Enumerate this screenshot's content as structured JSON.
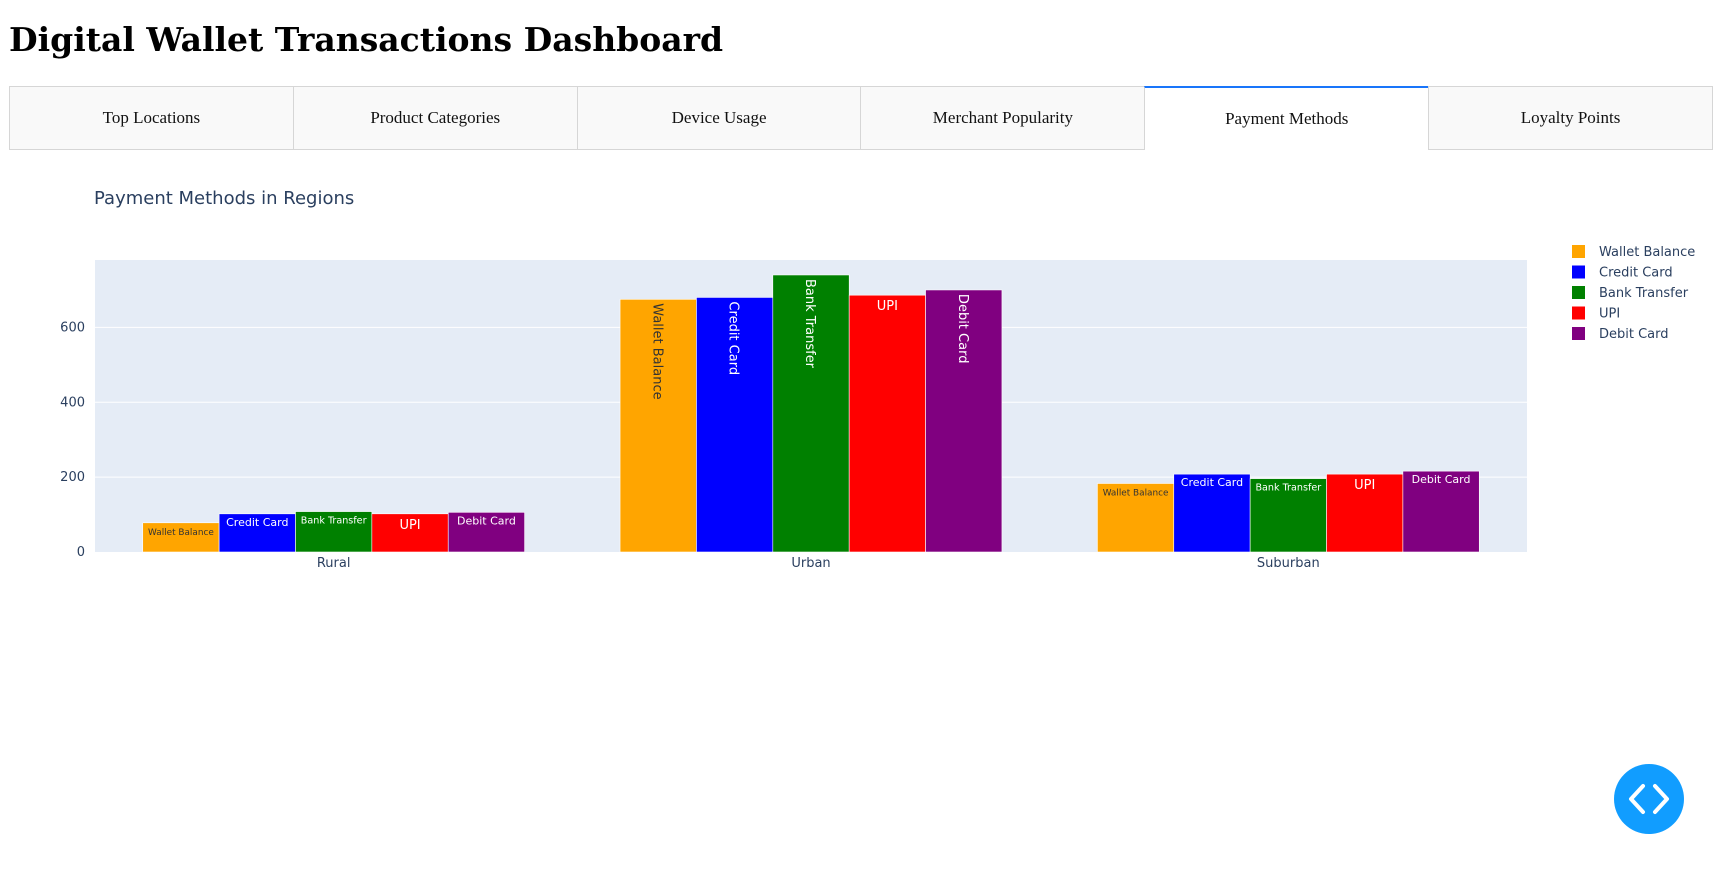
{
  "page": {
    "title": "Digital Wallet Transactions Dashboard"
  },
  "tabs": [
    {
      "label": "Top Locations",
      "selected": false
    },
    {
      "label": "Product Categories",
      "selected": false
    },
    {
      "label": "Device Usage",
      "selected": false
    },
    {
      "label": "Merchant Popularity",
      "selected": false
    },
    {
      "label": "Payment Methods",
      "selected": true
    },
    {
      "label": "Loyalty Points",
      "selected": false
    }
  ],
  "chart_data": {
    "type": "bar",
    "title": "Payment Methods in Regions",
    "xlabel": "",
    "ylabel": "",
    "categories": [
      "Rural",
      "Urban",
      "Suburban"
    ],
    "ylim": [
      0,
      780
    ],
    "yticks": [
      0,
      200,
      400,
      600
    ],
    "grid": true,
    "legend": "top-right",
    "series": [
      {
        "name": "Wallet Balance",
        "color": "#FFA500",
        "values": [
          78,
          675,
          183
        ]
      },
      {
        "name": "Credit Card",
        "color": "#0000FF",
        "values": [
          102,
          680,
          208
        ]
      },
      {
        "name": "Bank Transfer",
        "color": "#008000",
        "values": [
          108,
          740,
          196
        ]
      },
      {
        "name": "UPI",
        "color": "#FF0000",
        "values": [
          102,
          686,
          208
        ]
      },
      {
        "name": "Debit Card",
        "color": "#800080",
        "values": [
          106,
          700,
          216
        ]
      }
    ]
  },
  "fab": {
    "icon": "code-icon"
  }
}
